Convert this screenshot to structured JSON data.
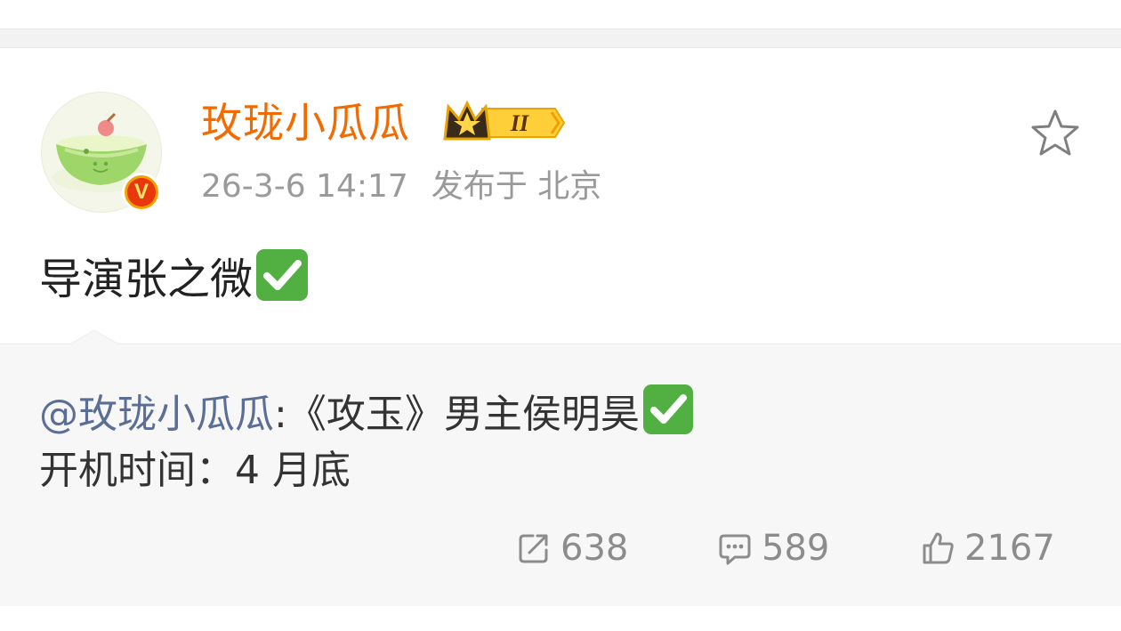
{
  "post": {
    "author": "玫珑小瓜瓜",
    "vip_level": "II",
    "verified_badge": "V",
    "timestamp": "26-3-6 14:17",
    "location": "发布于 北京",
    "text": "导演张之微"
  },
  "repost": {
    "mention": "@玫珑小瓜瓜",
    "colon_text": ":《攻玉》男主侯明昊",
    "line2": "开机时间：4 月底"
  },
  "actions": {
    "reposts": "638",
    "comments": "589",
    "likes": "2167"
  },
  "icons": {
    "favorite": "star-outline-icon",
    "repost": "share-arrow-icon",
    "comment": "comment-bubble-icon",
    "like": "thumbs-up-icon",
    "check": "check-mark-emoji",
    "vip": "crown-icon"
  },
  "colors": {
    "author": "#f26a00",
    "mention": "#5b6e95",
    "check_bg": "#52b043",
    "meta": "#9a9a9a",
    "action": "#8c8c8c"
  }
}
